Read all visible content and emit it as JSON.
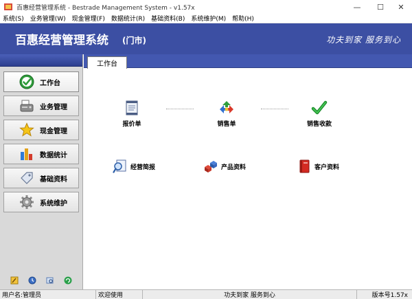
{
  "window": {
    "title": "百惠经营管理系统 - Bestrade Management System - v1.57x",
    "minimize_glyph": "—",
    "maximize_glyph": "☐",
    "close_glyph": "✕"
  },
  "menu": [
    {
      "label": "系统(S)"
    },
    {
      "label": "业务管理(W)"
    },
    {
      "label": "现金管理(F)"
    },
    {
      "label": "数据统计(R)"
    },
    {
      "label": "基础资料(B)"
    },
    {
      "label": "系统维护(M)"
    },
    {
      "label": "帮助(H)"
    }
  ],
  "banner": {
    "title": "百惠经营管理系统",
    "subtitle": "(门市)",
    "slogan": "功夫到家  服务到心",
    "bg_color": "#3c4fa3"
  },
  "sidebar": {
    "items": [
      {
        "label": "工作台",
        "icon": "green-check-circle-icon"
      },
      {
        "label": "业务管理",
        "icon": "fax-machine-icon"
      },
      {
        "label": "现金管理",
        "icon": "gold-star-icon"
      },
      {
        "label": "数据统计",
        "icon": "bar-chart-icon"
      },
      {
        "label": "基础资料",
        "icon": "tag-icon"
      },
      {
        "label": "系统维护",
        "icon": "gear-icon"
      }
    ],
    "footer_icons": [
      "edit-icon",
      "clock-icon",
      "search-window-icon",
      "refresh-icon"
    ]
  },
  "tabs": [
    {
      "label": "工作台"
    }
  ],
  "workflow": {
    "steps": [
      {
        "label": "报价单",
        "icon": "document-icon"
      },
      {
        "label": "销售单",
        "icon": "recycle-arrows-icon"
      },
      {
        "label": "销售收款",
        "icon": "green-checkmark-icon"
      }
    ]
  },
  "shortcuts": [
    {
      "label": "经营简报",
      "icon": "magnifier-report-icon"
    },
    {
      "label": "产品资料",
      "icon": "cubes-icon"
    },
    {
      "label": "客户资料",
      "icon": "red-book-icon"
    }
  ],
  "status": {
    "user": "用户名:管理员",
    "welcome": "欢迎使用",
    "slogan": "功夫到家 服务到心",
    "version": "版本号1.57x"
  }
}
